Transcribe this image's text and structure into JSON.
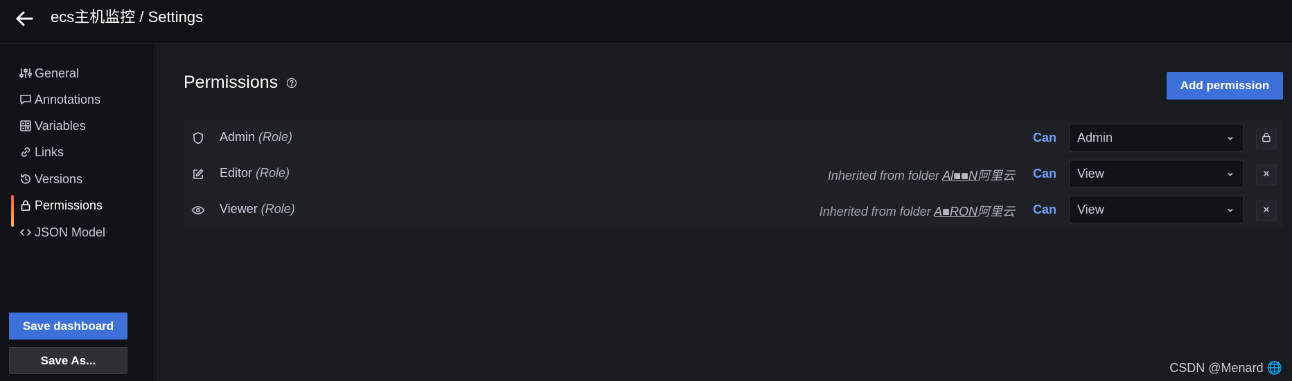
{
  "header": {
    "title": "ecs主机监控 / Settings"
  },
  "sidebar": {
    "items": [
      {
        "label": "General",
        "icon": "sliders-icon"
      },
      {
        "label": "Annotations",
        "icon": "comment-icon"
      },
      {
        "label": "Variables",
        "icon": "calculator-icon"
      },
      {
        "label": "Links",
        "icon": "link-icon"
      },
      {
        "label": "Versions",
        "icon": "history-icon"
      },
      {
        "label": "Permissions",
        "icon": "lock-icon",
        "active": true
      },
      {
        "label": "JSON Model",
        "icon": "code-icon"
      }
    ],
    "save_dashboard_label": "Save dashboard",
    "save_as_label": "Save As..."
  },
  "main": {
    "title": "Permissions",
    "add_permission_label": "Add permission",
    "rows": [
      {
        "icon": "shield-icon",
        "name": "Admin",
        "type": "(Role)",
        "inherited_prefix": "",
        "folder": "",
        "folder_suffix": "",
        "can": "Can",
        "permission": "Admin",
        "action": "lock-icon"
      },
      {
        "icon": "edit-icon",
        "name": "Editor",
        "type": "(Role)",
        "inherited_prefix": "Inherited from folder ",
        "folder": "Al■■N",
        "folder_suffix": "阿里云",
        "can": "Can",
        "permission": "View",
        "action": "close-icon"
      },
      {
        "icon": "eye-icon",
        "name": "Viewer",
        "type": "(Role)",
        "inherited_prefix": "Inherited from folder ",
        "folder": "A■RON",
        "folder_suffix": "阿里云",
        "can": "Can",
        "permission": "View",
        "action": "close-icon"
      }
    ]
  },
  "watermark": "CSDN @Menard 🌐",
  "colors": {
    "accent": "#3d71d9",
    "can_text": "#6e9fff",
    "background": "#111217",
    "panel": "#181b1f"
  }
}
